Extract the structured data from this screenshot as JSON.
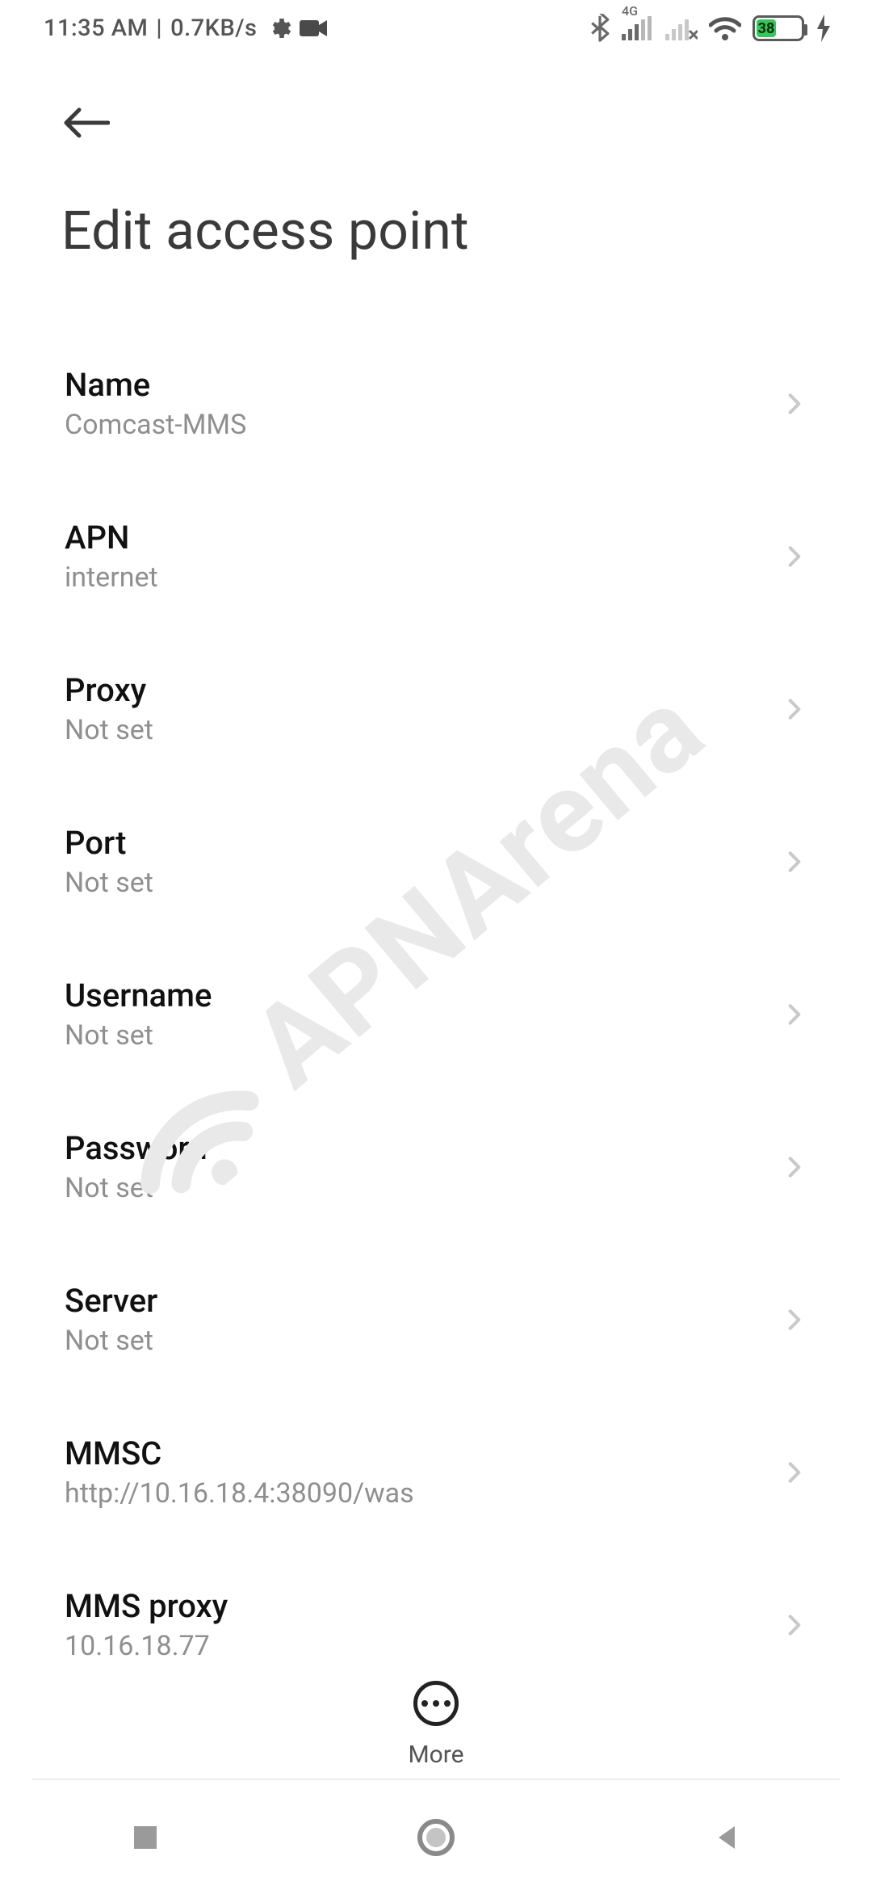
{
  "status": {
    "time": "11:35 AM",
    "sep": "|",
    "rate": "0.7KB/s",
    "net_label": "4G",
    "battery_pct": "38"
  },
  "header": {
    "title": "Edit access point"
  },
  "items": [
    {
      "label": "Name",
      "value": "Comcast-MMS"
    },
    {
      "label": "APN",
      "value": "internet"
    },
    {
      "label": "Proxy",
      "value": "Not set"
    },
    {
      "label": "Port",
      "value": "Not set"
    },
    {
      "label": "Username",
      "value": "Not set"
    },
    {
      "label": "Password",
      "value": "Not set"
    },
    {
      "label": "Server",
      "value": "Not set"
    },
    {
      "label": "MMSC",
      "value": "http://10.16.18.4:38090/was"
    },
    {
      "label": "MMS proxy",
      "value": "10.16.18.77"
    }
  ],
  "bottom": {
    "more_label": "More"
  },
  "watermark": "APNArena"
}
